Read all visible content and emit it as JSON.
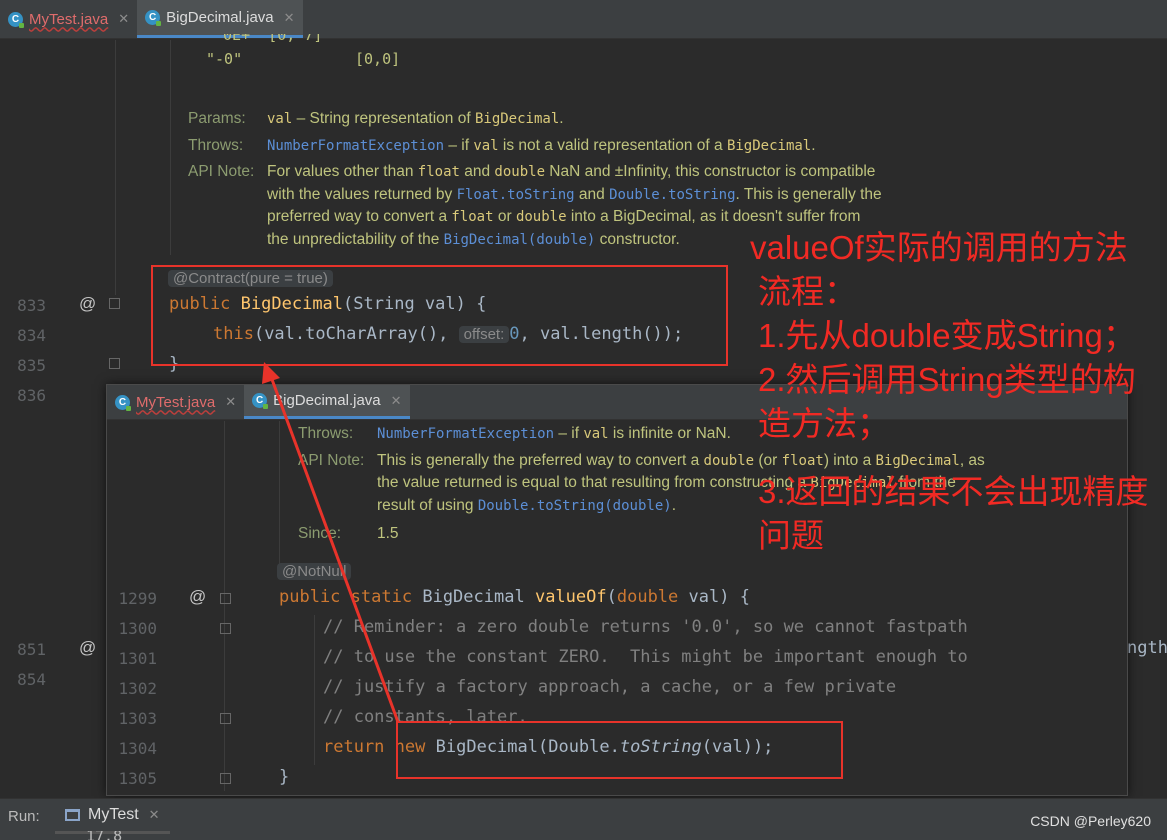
{
  "main_editor": {
    "tabs": [
      {
        "label": "MyTest.java",
        "error": true
      },
      {
        "label": "BigDecimal.java",
        "error": false
      }
    ],
    "doc_top_lines": [
      {
        "str": "\"-0\"",
        "val": "[0,0]"
      }
    ],
    "doc": {
      "params_label": "Params:",
      "params_text_code": "val",
      "params_text": " – String representation of ",
      "params_text_code2": "BigDecimal",
      "params_text_end": ".",
      "throws_label": "Throws:",
      "throws_link": "NumberFormatException",
      "throws_text1": " – if ",
      "throws_code": "val",
      "throws_text2": " is not a valid representation of a ",
      "throws_code2": "BigDecimal",
      "throws_end": ".",
      "apinote_label": "API Note:",
      "apinote_l1a": "For values other than ",
      "apinote_l1b": "float",
      "apinote_l1c": " and ",
      "apinote_l1d": "double",
      "apinote_l1e": " NaN and ±Infinity, this constructor is compatible",
      "apinote_l2a": "with the values returned by ",
      "apinote_l2b": "Float.toString",
      "apinote_l2c": " and ",
      "apinote_l2d": "Double.toString",
      "apinote_l2e": ". This is generally the",
      "apinote_l3a": "preferred way to convert a ",
      "apinote_l3b": "float",
      "apinote_l3c": " or ",
      "apinote_l3d": "double",
      "apinote_l3e": " into a BigDecimal, as it doesn't suffer from",
      "apinote_l4a": "the unpredictability of the ",
      "apinote_l4b": "BigDecimal(double)",
      "apinote_l4c": " constructor."
    },
    "contract_hint": "@Contract(pure = true)",
    "line_numbers": [
      "833",
      "834",
      "835",
      "836",
      "851",
      "854"
    ],
    "code": {
      "l833_kw": "public",
      "l833_type": "BigDecimal",
      "l833_rest": "(String val) {",
      "l834_kw": "this",
      "l834_a": "(val.toCharArray(), ",
      "l834_hint": "offset:",
      "l834_num": "0",
      "l834_b": ", val.length());",
      "l835": "}",
      "l851_tail": "ngth"
    }
  },
  "popup_editor": {
    "tabs": [
      {
        "label": "MyTest.java",
        "error": true
      },
      {
        "label": "BigDecimal.java",
        "error": false
      }
    ],
    "doc": {
      "throws_label": "Throws:",
      "throws_link": "NumberFormatException",
      "throws_text1": " – if ",
      "throws_code": "val",
      "throws_text2": " is infinite or NaN.",
      "apinote_label": "API Note:",
      "apinote_l1a": "This is generally the preferred way to convert a ",
      "apinote_l1b": "double",
      "apinote_l1c": " (or ",
      "apinote_l1d": "float",
      "apinote_l1e": ") into a ",
      "apinote_l1f": "BigDecimal",
      "apinote_l1g": ", as",
      "apinote_l2a": "the value returned is equal to that resulting from constructing a ",
      "apinote_l2b": "BigDecimal",
      "apinote_l2c": " from the",
      "apinote_l3a": "result of using ",
      "apinote_l3b": "Double.toString(double)",
      "apinote_l3c": ".",
      "since_label": "Since:",
      "since_value": "1.5"
    },
    "notnull_hint": "@NotNull",
    "line_numbers": [
      "1299",
      "1300",
      "1301",
      "1302",
      "1303",
      "1304",
      "1305"
    ],
    "code": {
      "l1299_kw1": "public",
      "l1299_kw2": "static",
      "l1299_type": "BigDecimal",
      "l1299_fn": "valueOf",
      "l1299_a": "(",
      "l1299_kw3": "double",
      "l1299_b": " val) {",
      "l1300": "// Reminder: a zero double returns '0.0', so we cannot fastpath",
      "l1301": "// to use the constant ZERO.  This might be important enough to",
      "l1302": "// justify a factory approach, a cache, or a few private",
      "l1303": "// constants, later.",
      "l1304_kw1": "return",
      "l1304_kw2": "new",
      "l1304_a": "BigDecimal(Double.",
      "l1304_fn": "toString",
      "l1304_b": "(val));",
      "l1305": "}"
    }
  },
  "annotation": {
    "lines": [
      "valueOf实际的调用的方法",
      "流程：",
      "1.先从double变成String；",
      "2.然后调用String类型的构",
      "造方法；",
      "3.返回的结果不会出现精度",
      "问题"
    ],
    "color": "#f12a24"
  },
  "run_bar": {
    "label": "Run:",
    "tab": "MyTest",
    "output_partial": "17.8"
  },
  "watermark": "CSDN @Perley620"
}
